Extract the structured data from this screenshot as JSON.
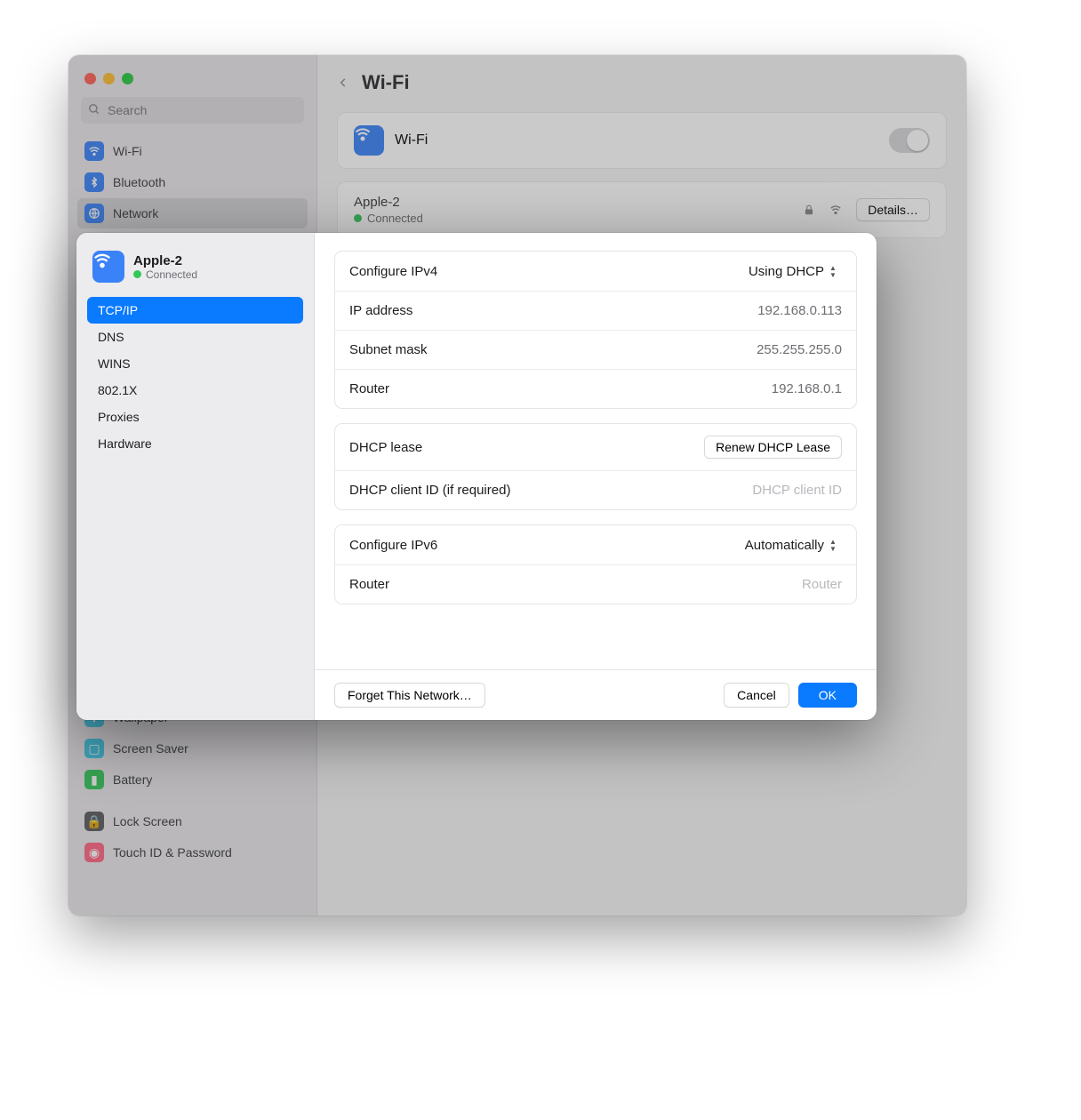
{
  "window": {
    "search_placeholder": "Search",
    "header_title": "Wi-Fi"
  },
  "bg_sidebar": {
    "items": [
      {
        "label": "Wi-Fi"
      },
      {
        "label": "Bluetooth"
      },
      {
        "label": "Network"
      },
      {
        "label": "Wallpaper"
      },
      {
        "label": "Screen Saver"
      },
      {
        "label": "Battery"
      },
      {
        "label": "Lock Screen"
      },
      {
        "label": "Touch ID & Password"
      }
    ]
  },
  "bg_panel": {
    "wifi_label": "Wi-Fi",
    "network_name": "Apple-2",
    "network_status": "Connected",
    "details_label": "Details…"
  },
  "modal": {
    "network_name": "Apple-2",
    "network_status": "Connected",
    "tabs": [
      {
        "label": "TCP/IP"
      },
      {
        "label": "DNS"
      },
      {
        "label": "WINS"
      },
      {
        "label": "802.1X"
      },
      {
        "label": "Proxies"
      },
      {
        "label": "Hardware"
      }
    ],
    "tcpip": {
      "configure_ipv4_label": "Configure IPv4",
      "configure_ipv4_value": "Using DHCP",
      "ip_label": "IP address",
      "ip_value": "192.168.0.113",
      "subnet_label": "Subnet mask",
      "subnet_value": "255.255.255.0",
      "router_label": "Router",
      "router_value": "192.168.0.1",
      "dhcp_lease_label": "DHCP lease",
      "renew_button": "Renew DHCP Lease",
      "dhcp_client_id_label": "DHCP client ID (if required)",
      "dhcp_client_id_placeholder": "DHCP client ID",
      "configure_ipv6_label": "Configure IPv6",
      "configure_ipv6_value": "Automatically",
      "router6_label": "Router",
      "router6_placeholder": "Router"
    },
    "footer": {
      "forget": "Forget This Network…",
      "cancel": "Cancel",
      "ok": "OK"
    }
  }
}
